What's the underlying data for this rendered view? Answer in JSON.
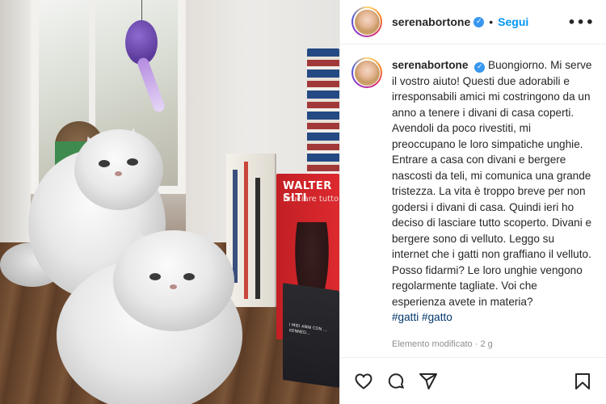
{
  "post": {
    "username": "serenabortone",
    "follow_label": "Segui",
    "separator": "•",
    "more_label": "•••",
    "caption_text": "Buongiorno. Mi serve il vostro aiuto! Questi due adorabili e irresponsabili amici mi costringono da un anno a tenere i divani di casa coperti. Avendoli da poco rivestiti, mi preoccupano le loro simpatiche unghie. Entrare a casa con divani e bergere nascosti da teli, mi comunica una grande tristezza. La vita è troppo breve per non godersi i divani di casa. Quindi ieri ho deciso di lasciare tutto scoperto. Divani e bergere sono di velluto. Leggo su internet che i gatti non graffiano il velluto. Posso fidarmi? Le loro unghie vengono regolarmente tagliate. Voi che esperienza avete in materia?",
    "hashtags": [
      "#gatti",
      "#gatto"
    ],
    "edited_label": "Elemento modificato",
    "edited_sep": "·",
    "time_ago": "2 g"
  },
  "photo": {
    "book_author": "WALTER SITI",
    "book_title": "Bruciare tutto",
    "book_small_text": "I MIEI ANNI CON ... KENNED..."
  },
  "icons": {
    "verified": "verified-badge-icon",
    "like": "heart-icon",
    "comment": "comment-icon",
    "share": "send-icon",
    "save": "bookmark-icon"
  },
  "colors": {
    "follow": "#0095f6",
    "verified": "#3897f0",
    "hashtag": "#00376b",
    "meta": "#8e8e8e"
  }
}
